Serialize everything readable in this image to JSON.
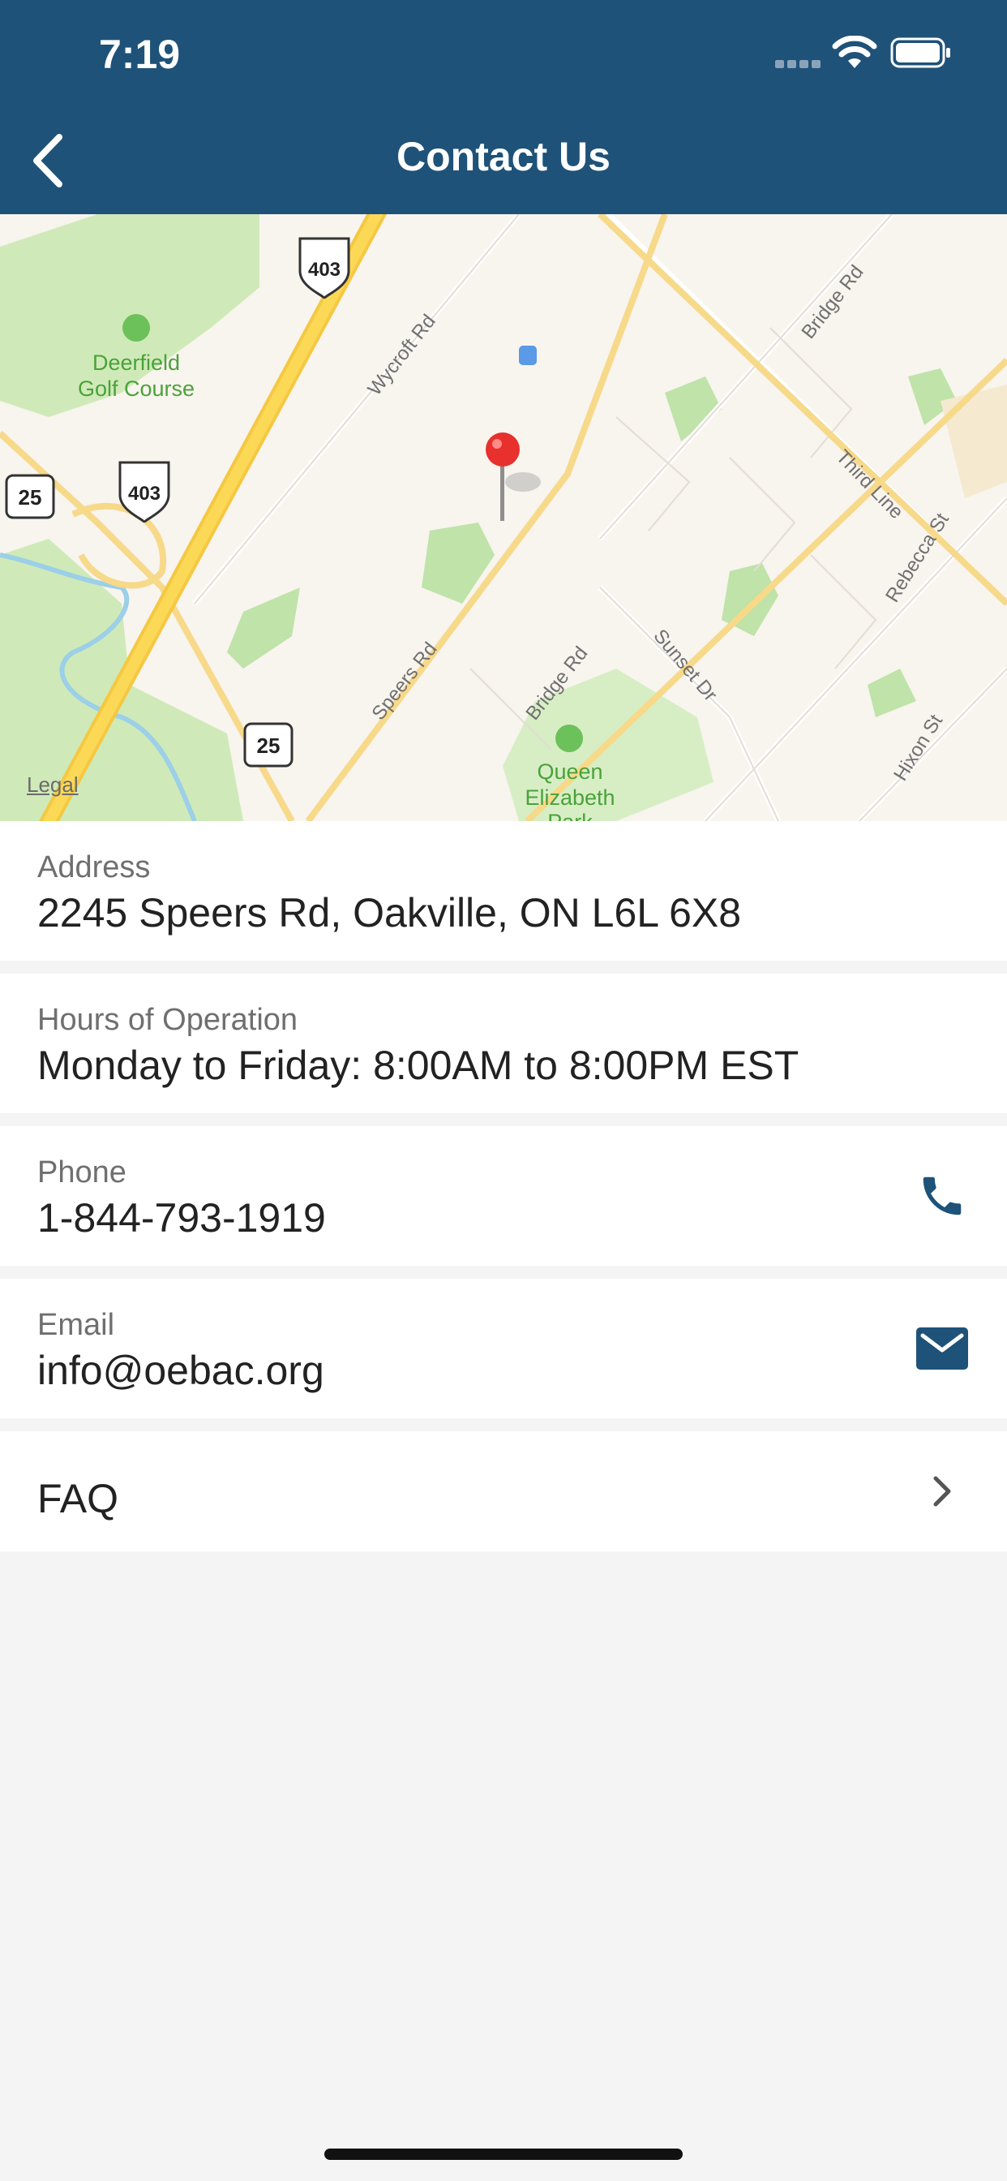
{
  "status_bar": {
    "time": "7:19"
  },
  "header": {
    "title": "Contact Us",
    "back_icon": "chevron-left-icon"
  },
  "map": {
    "legal_label": "Legal",
    "labels": {
      "golf": "Deerfield",
      "golf2": "Golf Course",
      "park1": "Queen",
      "park2": "Elizabeth",
      "park3": "Park",
      "wycroft": "Wycroft Rd",
      "speers": "Speers Rd",
      "bridge1": "Bridge Rd",
      "bridge2": "Bridge Rd",
      "sunset": "Sunset Dr",
      "third": "Third Line",
      "rebecca": "Rebecca St",
      "hixon": "Hixon St"
    },
    "shields": {
      "hwy403": "403",
      "hwy25": "25"
    }
  },
  "contact": {
    "address": {
      "label": "Address",
      "value": "2245 Speers Rd, Oakville, ON L6L 6X8"
    },
    "hours": {
      "label": "Hours of Operation",
      "value": "Monday to Friday:  8:00AM to 8:00PM EST"
    },
    "phone": {
      "label": "Phone",
      "value": "1-844-793-1919",
      "icon": "phone-icon"
    },
    "email": {
      "label": "Email",
      "value": "info@oebac.org",
      "icon": "mail-icon"
    },
    "faq": {
      "label": "FAQ",
      "icon": "chevron-right-icon"
    }
  },
  "colors": {
    "header": "#1e5279",
    "accent": "#1e5279",
    "pin": "#e8302c"
  }
}
